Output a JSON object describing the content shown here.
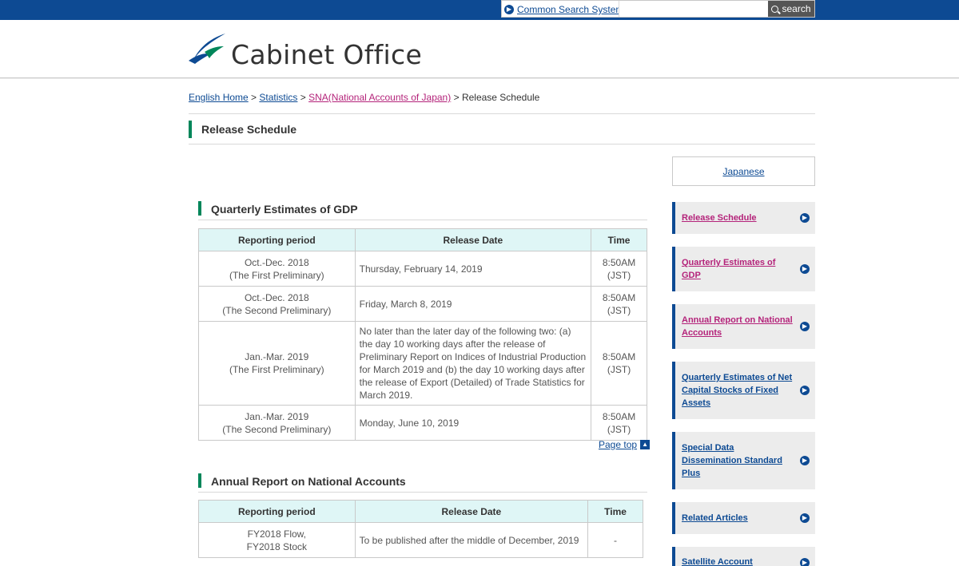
{
  "topbar": {
    "common_search_link": "Common Search System",
    "search_placeholder": "",
    "search_button": "search"
  },
  "header": {
    "site_name": "Cabinet Office",
    "brand_color": "#0d4a93"
  },
  "breadcrumb": {
    "items": [
      "English Home",
      "Statistics",
      "SNA(National Accounts of Japan)",
      "Release Schedule"
    ],
    "separator": ">"
  },
  "page_title": "Release Schedule",
  "sections": [
    {
      "title": "Quarterly Estimates of GDP",
      "headers": [
        "Reporting period",
        "Release Date",
        "Time"
      ],
      "rows": [
        {
          "period": [
            "Oct.-Dec. 2018",
            "(The First Preliminary)"
          ],
          "date": "Thursday, February 14, 2019",
          "time": [
            "8:50AM",
            "(JST)"
          ]
        },
        {
          "period": [
            "Oct.-Dec. 2018",
            "(The Second Preliminary)"
          ],
          "date": "Friday, March 8, 2019",
          "time": [
            "8:50AM",
            "(JST)"
          ]
        },
        {
          "period": [
            "Jan.-Mar. 2019",
            "(The First Preliminary)"
          ],
          "date": "No later than the later day of the following two: (a) the day 10 working days after the release of Preliminary Report on Indices of Industrial Production for March 2019 and (b) the day 10 working days after the release of Export (Detailed) of Trade Statistics for March 2019.",
          "time": [
            "8:50AM",
            "(JST)"
          ]
        },
        {
          "period": [
            "Jan.-Mar. 2019",
            "(The Second Preliminary)"
          ],
          "date": "Monday, June 10, 2019",
          "time": [
            "8:50AM",
            "(JST)"
          ]
        }
      ]
    },
    {
      "title": "Annual Report on National Accounts",
      "headers": [
        "Reporting period",
        "Release Date",
        "Time"
      ],
      "rows": [
        {
          "period": [
            "FY2018 Flow,",
            "FY2018 Stock"
          ],
          "date": "To be published after the middle of December, 2019",
          "time": [
            "-"
          ]
        }
      ]
    }
  ],
  "page_top": "Page top",
  "sidebar": {
    "language_link": "Japanese",
    "items": [
      {
        "label": "Release Schedule",
        "color": "#b4237a"
      },
      {
        "label": "Quarterly Estimates of GDP",
        "color": "#b4237a"
      },
      {
        "label": "Annual Report on National Accounts",
        "color": "#b4237a"
      },
      {
        "label": "Quarterly Estimates of Net Capital Stocks of Fixed Assets",
        "color": "#0d4a93"
      },
      {
        "label": "Special Data Dissemination Standard Plus",
        "color": "#0d4a93"
      },
      {
        "label": "Related Articles",
        "color": "#0d4a93"
      },
      {
        "label": "Satellite Account",
        "color": "#0d4a93"
      }
    ]
  },
  "colors": {
    "accent_green": "#00865a",
    "table_header_bg": "#dff6f6",
    "sidebar_bg": "#ececec"
  }
}
